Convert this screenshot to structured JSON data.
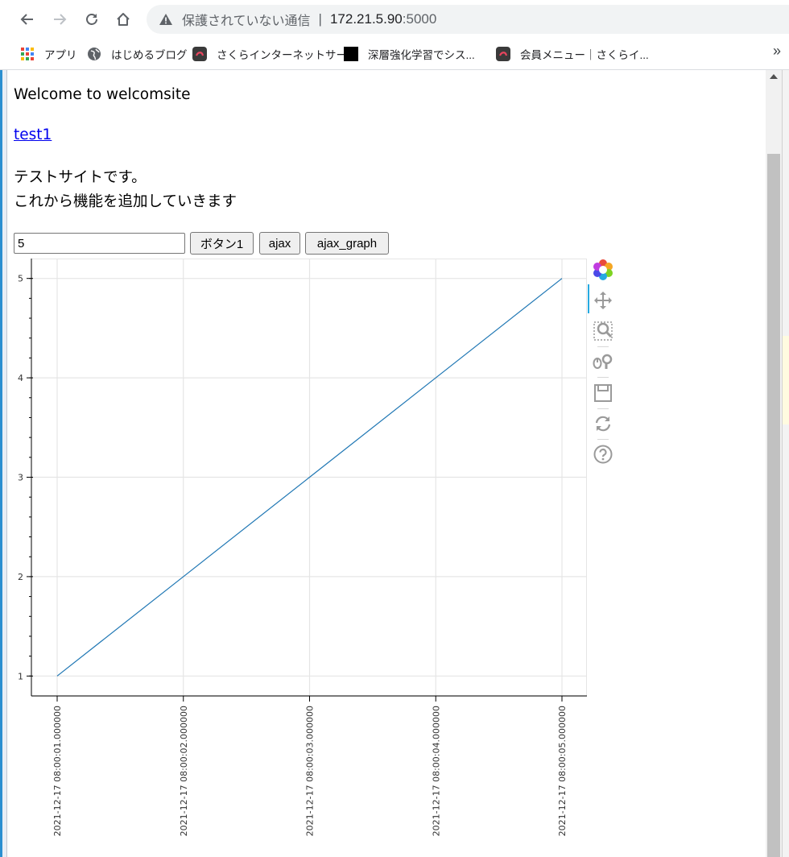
{
  "browser": {
    "security_label": "保護されていない通信",
    "separator": "|",
    "url_host": "172.21.5.90",
    "url_port": ":5000",
    "bookmarks": [
      {
        "label": "アプリ",
        "icon": "apps-grid-icon"
      },
      {
        "label": "はじめるブログ",
        "icon": "globe-icon"
      },
      {
        "label": "さくらインターネットサー...",
        "icon": "sakura-icon"
      },
      {
        "label": "深層強化学習でシス...",
        "icon": "black-square-icon"
      },
      {
        "label": "会員メニュー｜さくらイ...",
        "icon": "sakura-icon"
      }
    ],
    "more_label": "»"
  },
  "page": {
    "welcome": "Welcome to welcomsite",
    "link_text": "test1",
    "desc_line1": "テストサイトです。",
    "desc_line2": "これから機能を追加していきます",
    "input_value": "5",
    "button1_label": "ボタン1",
    "ajax_label": "ajax",
    "ajax_graph_label": "ajax_graph"
  },
  "toolbar": {
    "tools": [
      "bokeh-logo-icon",
      "pan-icon",
      "box-zoom-icon",
      "wheel-zoom-icon",
      "save-icon",
      "reset-icon",
      "help-icon"
    ]
  },
  "chart_data": {
    "type": "line",
    "title": "",
    "xlabel": "",
    "ylabel": "",
    "x": [
      "2021-12-17 08:00:01.000000",
      "2021-12-17 08:00:02.000000",
      "2021-12-17 08:00:03.000000",
      "2021-12-17 08:00:04.000000",
      "2021-12-17 08:00:05.000000"
    ],
    "series": [
      {
        "values": [
          1,
          2,
          3,
          4,
          5
        ],
        "color": "#1f77b4"
      }
    ],
    "yticks": [
      1,
      2,
      3,
      4,
      5
    ],
    "ylim": [
      0.8,
      5.2
    ],
    "grid": true,
    "legend": "none"
  }
}
